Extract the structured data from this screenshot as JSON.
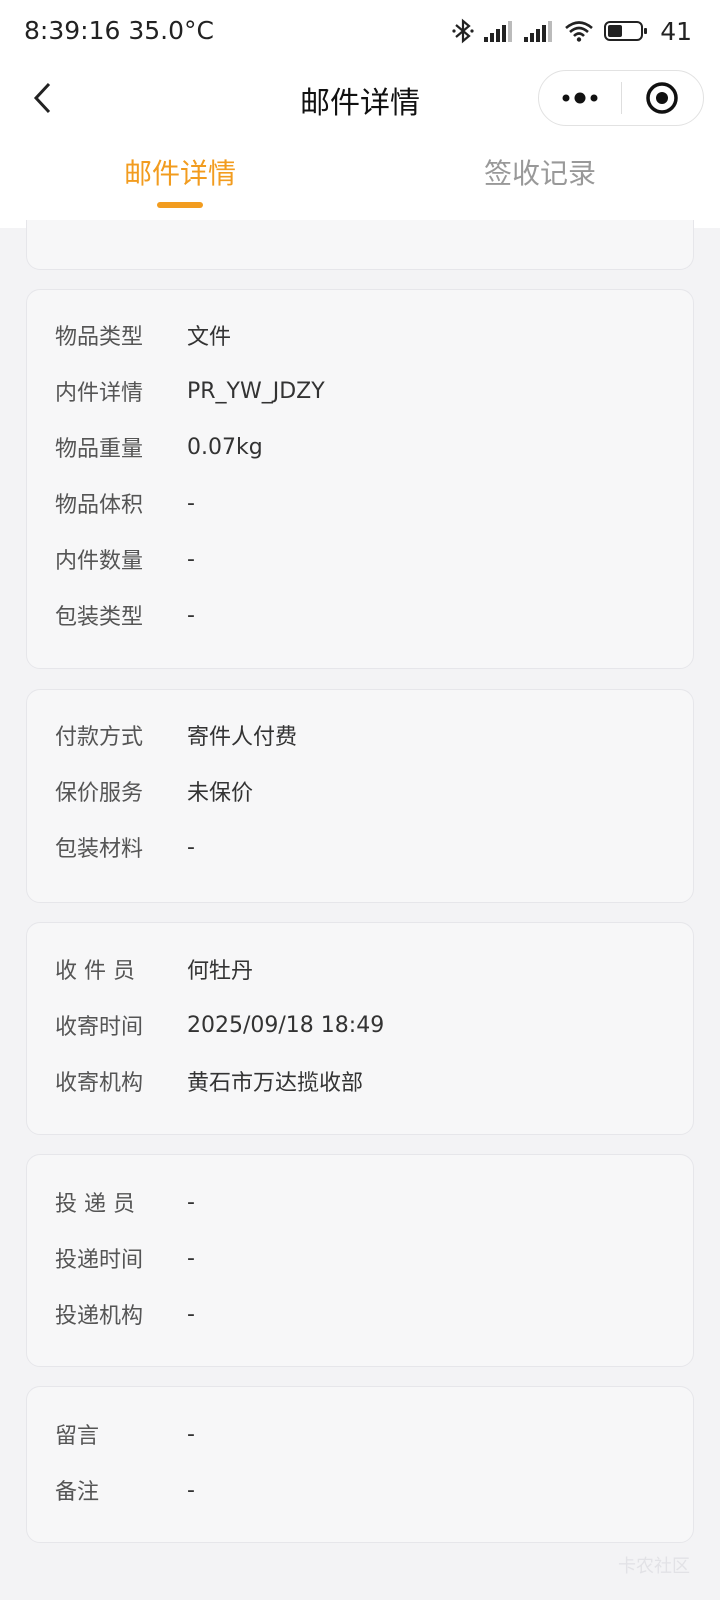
{
  "status_bar": {
    "time": "8:39:16",
    "temperature": "35.0°C",
    "battery": "41",
    "icons": [
      "bluetooth-icon",
      "signal-icon",
      "signal-icon",
      "wifi-icon",
      "battery-icon"
    ]
  },
  "nav": {
    "title": "邮件详情",
    "back_icon": "chevron-left-icon",
    "more_icon": "more-dots-icon",
    "close_icon": "target-icon"
  },
  "tabs": [
    {
      "label": "邮件详情",
      "active": true
    },
    {
      "label": "签收记录",
      "active": false
    }
  ],
  "accent_color": "#f29c1f",
  "cards": {
    "item": [
      {
        "label": "物品类型",
        "value": "文件"
      },
      {
        "label": "内件详情",
        "value": "PR_YW_JDZY"
      },
      {
        "label": "物品重量",
        "value": "0.07kg"
      },
      {
        "label": "物品体积",
        "value": "-"
      },
      {
        "label": "内件数量",
        "value": "-"
      },
      {
        "label": "包装类型",
        "value": "-"
      }
    ],
    "payment": [
      {
        "label": "付款方式",
        "value": "寄件人付费"
      },
      {
        "label": "保价服务",
        "value": "未保价"
      },
      {
        "label": "包装材料",
        "value": "-"
      }
    ],
    "pickup": [
      {
        "label": "收 件 员",
        "value": "何牡丹"
      },
      {
        "label": "收寄时间",
        "value": "2025/09/18 18:49"
      },
      {
        "label": "收寄机构",
        "value": "黄石市万达揽收部"
      }
    ],
    "delivery": [
      {
        "label": "投 递 员",
        "value": "-"
      },
      {
        "label": "投递时间",
        "value": "-"
      },
      {
        "label": "投递机构",
        "value": "-"
      }
    ],
    "notes": [
      {
        "label": "留言",
        "value": "-"
      },
      {
        "label": "备注",
        "value": "-"
      }
    ]
  },
  "watermark": "卡农社区"
}
